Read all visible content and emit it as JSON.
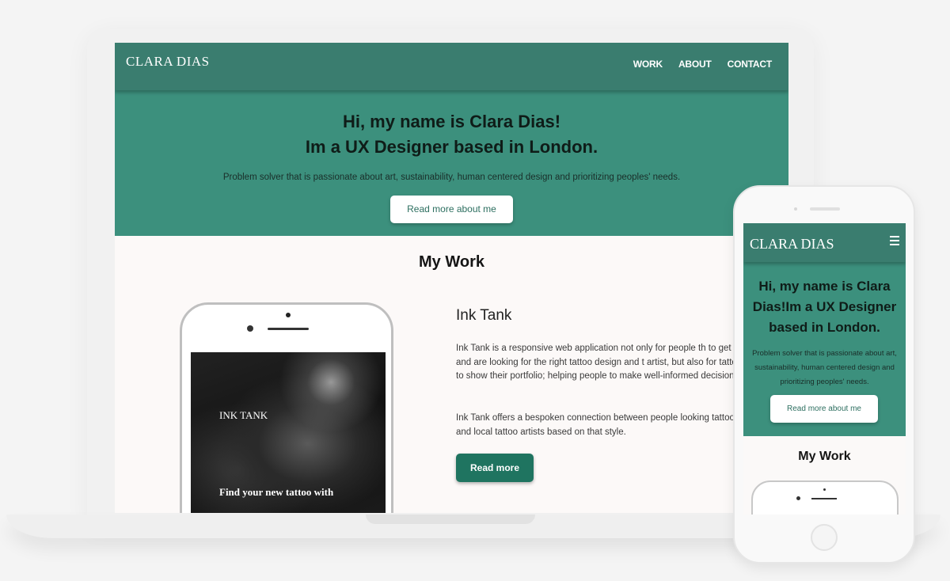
{
  "colors": {
    "nav": "#3a7d6f",
    "hero": "#3c907d",
    "button_primary": "#1f7460",
    "page_bg": "#fcf9f8"
  },
  "desktop": {
    "logo": "CLARA DIAS",
    "nav": [
      "WORK",
      "ABOUT",
      "CONTACT"
    ],
    "hero": {
      "title_line1": "Hi, my name is Clara Dias!",
      "title_line2": "Im a UX Designer based in London.",
      "subtitle": "Problem solver that is passionate about art, sustainability, human centered design and prioritizing peoples' needs.",
      "button": "Read more about me"
    },
    "section_title": "My Work",
    "project": {
      "image_title": "INK TANK",
      "image_caption": "Find your new tattoo with",
      "title": "Ink Tank",
      "paragraph1": "Ink Tank is a responsive web application not only for people th to get a tattoo and are looking for the right tattoo design and t artist, but also for tattoo artists to show their portfolio; helping people to make well-informed decisions.",
      "paragraph2": "Ink Tank offers a bespoken connection between people looking tattoo style and local tattoo artists based on that style.",
      "button": "Read more"
    }
  },
  "mobile": {
    "logo": "CLARA DIAS",
    "menu_icon": "hamburger-menu-icon",
    "hero": {
      "title": "Hi, my name is Clara Dias!Im a UX Designer based in London.",
      "subtitle": "Problem solver that is passionate about art, sustainability, human centered design and prioritizing peoples' needs.",
      "button": "Read more about me"
    },
    "section_title": "My Work"
  }
}
